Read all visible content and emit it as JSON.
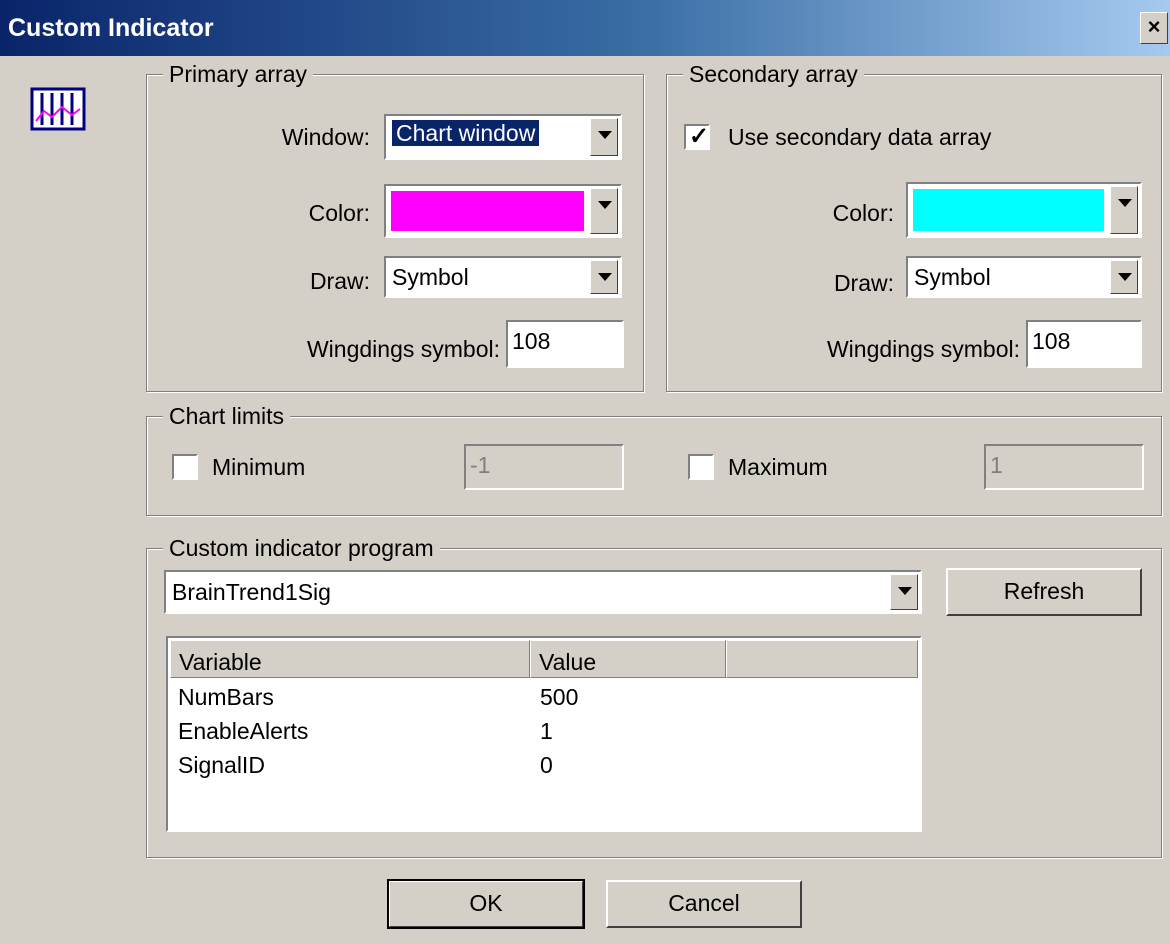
{
  "window": {
    "title": "Custom Indicator",
    "close_label": "×"
  },
  "icons": {
    "app": "indicator-chart-icon",
    "close": "close-icon"
  },
  "colors": {
    "primary": "#ff00ff",
    "secondary": "#00ffff",
    "title_start": "#0a246a",
    "title_end": "#a6caf0"
  },
  "primary": {
    "title": "Primary array",
    "window_label": "Window:",
    "window_value": "Chart window",
    "color_label": "Color:",
    "draw_label": "Draw:",
    "draw_value": "Symbol",
    "wingdings_label": "Wingdings symbol:",
    "wingdings_value": "108"
  },
  "secondary": {
    "title": "Secondary array",
    "use_label": "Use secondary data array",
    "use_checked": true,
    "color_label": "Color:",
    "draw_label": "Draw:",
    "draw_value": "Symbol",
    "wingdings_label": "Wingdings symbol:",
    "wingdings_value": "108"
  },
  "limits": {
    "title": "Chart limits",
    "min_label": "Minimum",
    "min_value": "-1",
    "max_label": "Maximum",
    "max_value": "1"
  },
  "program": {
    "title": "Custom indicator program",
    "selected": "BrainTrend1Sig",
    "refresh_label": "Refresh",
    "columns": [
      "Variable",
      "Value"
    ],
    "rows": [
      {
        "variable": "NumBars",
        "value": "500"
      },
      {
        "variable": "EnableAlerts",
        "value": "1"
      },
      {
        "variable": "SignalID",
        "value": "0"
      }
    ]
  },
  "buttons": {
    "ok": "OK",
    "cancel": "Cancel"
  }
}
